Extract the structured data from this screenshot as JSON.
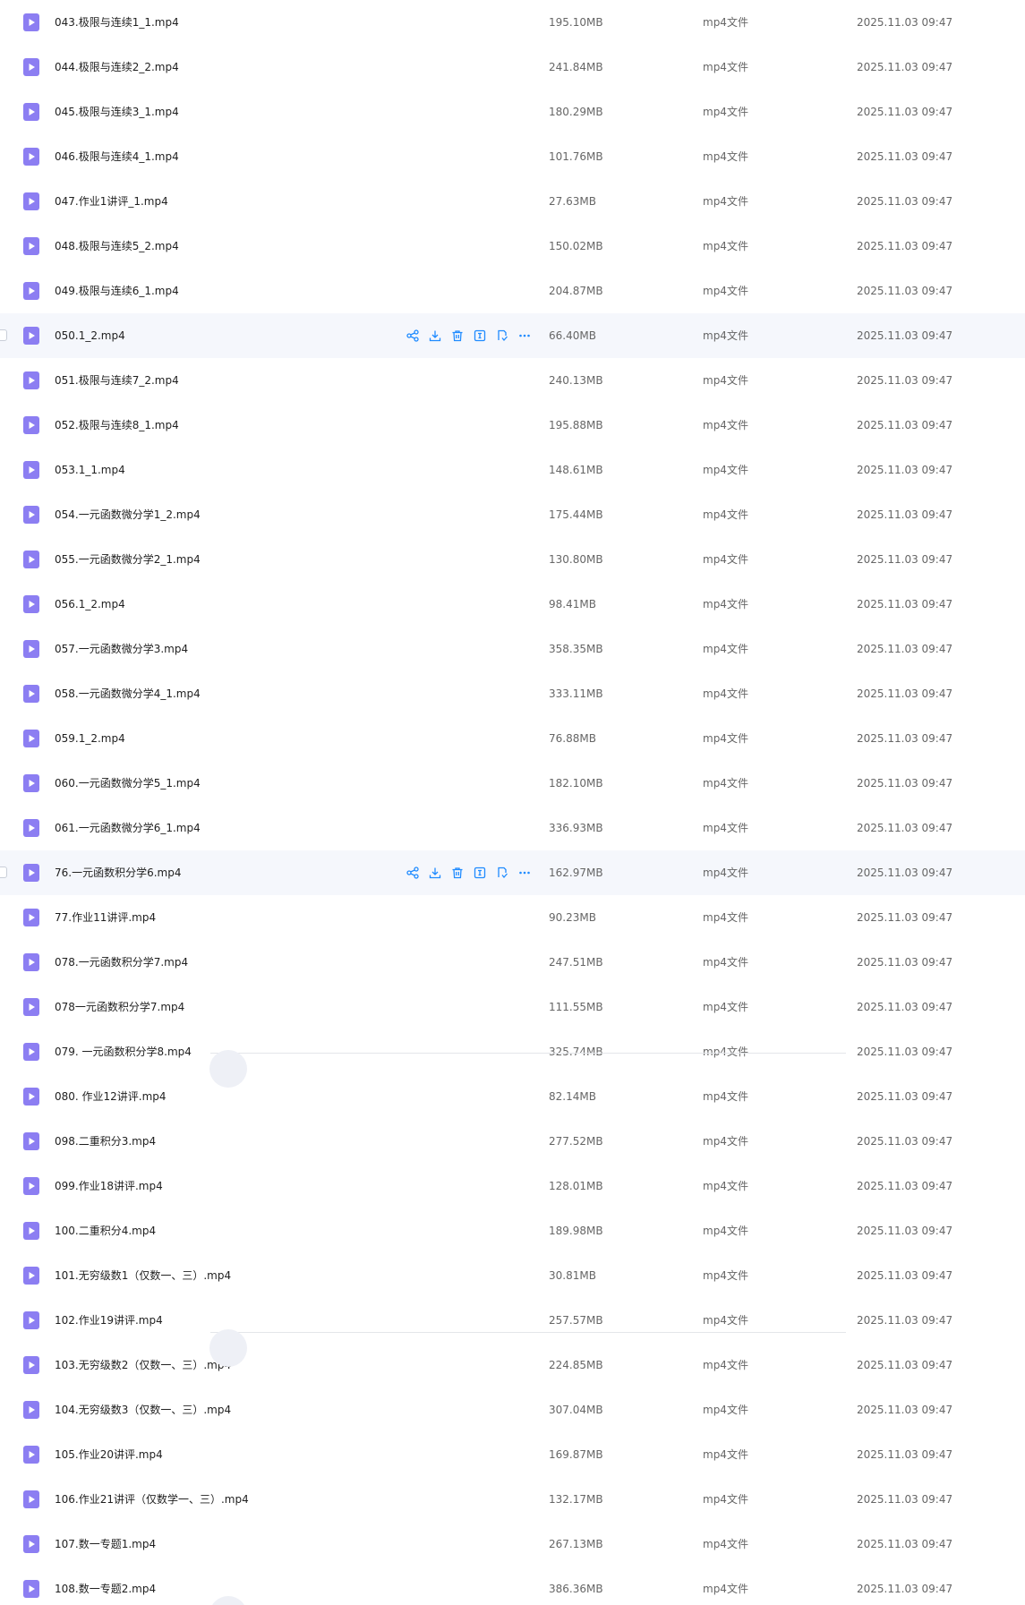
{
  "colors": {
    "icon_bg": "#8c7ef2",
    "action_blue": "#1f8bff",
    "hover_bg": "#f5f7fc"
  },
  "icons": {
    "file": "video-file-icon",
    "actions": [
      "share-icon",
      "download-icon",
      "delete-icon",
      "rename-icon",
      "copy-icon",
      "more-icon"
    ]
  },
  "files": [
    {
      "name": "043.极限与连续1_1.mp4",
      "size": "195.10MB",
      "type": "mp4文件",
      "date": "2025.11.03 09:47"
    },
    {
      "name": "044.极限与连续2_2.mp4",
      "size": "241.84MB",
      "type": "mp4文件",
      "date": "2025.11.03 09:47"
    },
    {
      "name": "045.极限与连续3_1.mp4",
      "size": "180.29MB",
      "type": "mp4文件",
      "date": "2025.11.03 09:47"
    },
    {
      "name": "046.极限与连续4_1.mp4",
      "size": "101.76MB",
      "type": "mp4文件",
      "date": "2025.11.03 09:47"
    },
    {
      "name": "047.作业1讲评_1.mp4",
      "size": "27.63MB",
      "type": "mp4文件",
      "date": "2025.11.03 09:47"
    },
    {
      "name": "048.极限与连续5_2.mp4",
      "size": "150.02MB",
      "type": "mp4文件",
      "date": "2025.11.03 09:47"
    },
    {
      "name": "049.极限与连续6_1.mp4",
      "size": "204.87MB",
      "type": "mp4文件",
      "date": "2025.11.03 09:47"
    },
    {
      "name": "050.1_2.mp4",
      "size": "66.40MB",
      "type": "mp4文件",
      "date": "2025.11.03 09:47",
      "hover": true
    },
    {
      "name": "051.极限与连续7_2.mp4",
      "size": "240.13MB",
      "type": "mp4文件",
      "date": "2025.11.03 09:47"
    },
    {
      "name": "052.极限与连续8_1.mp4",
      "size": "195.88MB",
      "type": "mp4文件",
      "date": "2025.11.03 09:47"
    },
    {
      "name": "053.1_1.mp4",
      "size": "148.61MB",
      "type": "mp4文件",
      "date": "2025.11.03 09:47"
    },
    {
      "name": "054.一元函数微分学1_2.mp4",
      "size": "175.44MB",
      "type": "mp4文件",
      "date": "2025.11.03 09:47"
    },
    {
      "name": "055.一元函数微分学2_1.mp4",
      "size": "130.80MB",
      "type": "mp4文件",
      "date": "2025.11.03 09:47"
    },
    {
      "name": "056.1_2.mp4",
      "size": "98.41MB",
      "type": "mp4文件",
      "date": "2025.11.03 09:47"
    },
    {
      "name": "057.一元函数微分学3.mp4",
      "size": "358.35MB",
      "type": "mp4文件",
      "date": "2025.11.03 09:47"
    },
    {
      "name": "058.一元函数微分学4_1.mp4",
      "size": "333.11MB",
      "type": "mp4文件",
      "date": "2025.11.03 09:47"
    },
    {
      "name": "059.1_2.mp4",
      "size": "76.88MB",
      "type": "mp4文件",
      "date": "2025.11.03 09:47"
    },
    {
      "name": "060.一元函数微分学5_1.mp4",
      "size": "182.10MB",
      "type": "mp4文件",
      "date": "2025.11.03 09:47"
    },
    {
      "name": "061.一元函数微分学6_1.mp4",
      "size": "336.93MB",
      "type": "mp4文件",
      "date": "2025.11.03 09:47"
    },
    {
      "name": "76.一元函数积分学6.mp4",
      "size": "162.97MB",
      "type": "mp4文件",
      "date": "2025.11.03 09:47",
      "hover": true
    },
    {
      "name": "77.作业11讲评.mp4",
      "size": "90.23MB",
      "type": "mp4文件",
      "date": "2025.11.03 09:47"
    },
    {
      "name": "078.一元函数积分学7.mp4",
      "size": "247.51MB",
      "type": "mp4文件",
      "date": "2025.11.03 09:47"
    },
    {
      "name": "078一元函数积分学7.mp4",
      "size": "111.55MB",
      "type": "mp4文件",
      "date": "2025.11.03 09:47"
    },
    {
      "name": "079. 一元函数积分学8.mp4",
      "size": "325.74MB",
      "type": "mp4文件",
      "date": "2025.11.03 09:47"
    },
    {
      "name": "080. 作业12讲评.mp4",
      "size": "82.14MB",
      "type": "mp4文件",
      "date": "2025.11.03 09:47"
    },
    {
      "name": "098.二重积分3.mp4",
      "size": "277.52MB",
      "type": "mp4文件",
      "date": "2025.11.03 09:47"
    },
    {
      "name": "099.作业18讲评.mp4",
      "size": "128.01MB",
      "type": "mp4文件",
      "date": "2025.11.03 09:47"
    },
    {
      "name": "100.二重积分4.mp4",
      "size": "189.98MB",
      "type": "mp4文件",
      "date": "2025.11.03 09:47"
    },
    {
      "name": "101.无穷级数1（仅数一、三）.mp4",
      "size": "30.81MB",
      "type": "mp4文件",
      "date": "2025.11.03 09:47"
    },
    {
      "name": "102.作业19讲评.mp4",
      "size": "257.57MB",
      "type": "mp4文件",
      "date": "2025.11.03 09:47"
    },
    {
      "name": "103.无穷级数2（仅数一、三）.mp4",
      "size": "224.85MB",
      "type": "mp4文件",
      "date": "2025.11.03 09:47"
    },
    {
      "name": "104.无穷级数3（仅数一、三）.mp4",
      "size": "307.04MB",
      "type": "mp4文件",
      "date": "2025.11.03 09:47"
    },
    {
      "name": "105.作业20讲评.mp4",
      "size": "169.87MB",
      "type": "mp4文件",
      "date": "2025.11.03 09:47"
    },
    {
      "name": "106.作业21讲评（仅数学一、三）.mp4",
      "size": "132.17MB",
      "type": "mp4文件",
      "date": "2025.11.03 09:47"
    },
    {
      "name": "107.数一专题1.mp4",
      "size": "267.13MB",
      "type": "mp4文件",
      "date": "2025.11.03 09:47"
    },
    {
      "name": "108.数一专题2.mp4",
      "size": "386.36MB",
      "type": "mp4文件",
      "date": "2025.11.03 09:47"
    }
  ]
}
